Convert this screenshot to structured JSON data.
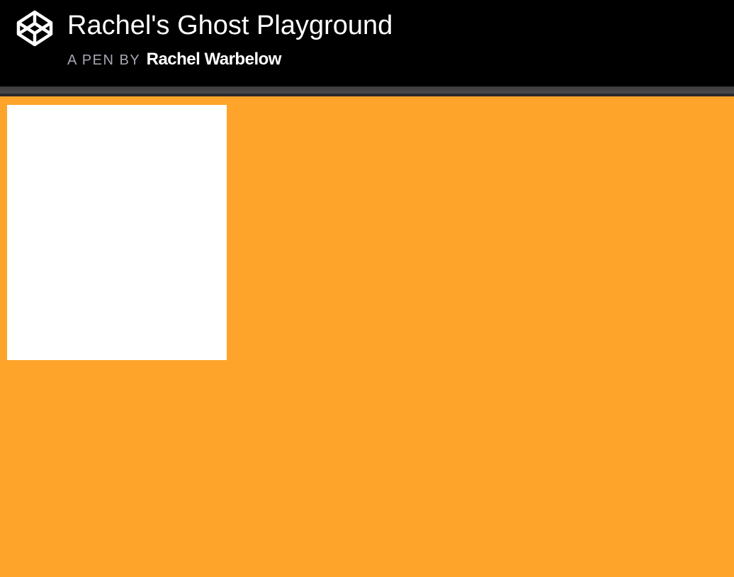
{
  "header": {
    "title": "Rachel's Ghost Playground",
    "byline_prefix": "A PEN BY",
    "author": "Rachel Warbelow",
    "logo_icon": "codepen-icon"
  },
  "colors": {
    "header_bg": "#000000",
    "stage_bg": "#ffa42b",
    "box_bg": "#ffffff",
    "byline_prefix": "#a7a7b5",
    "text": "#ffffff"
  }
}
